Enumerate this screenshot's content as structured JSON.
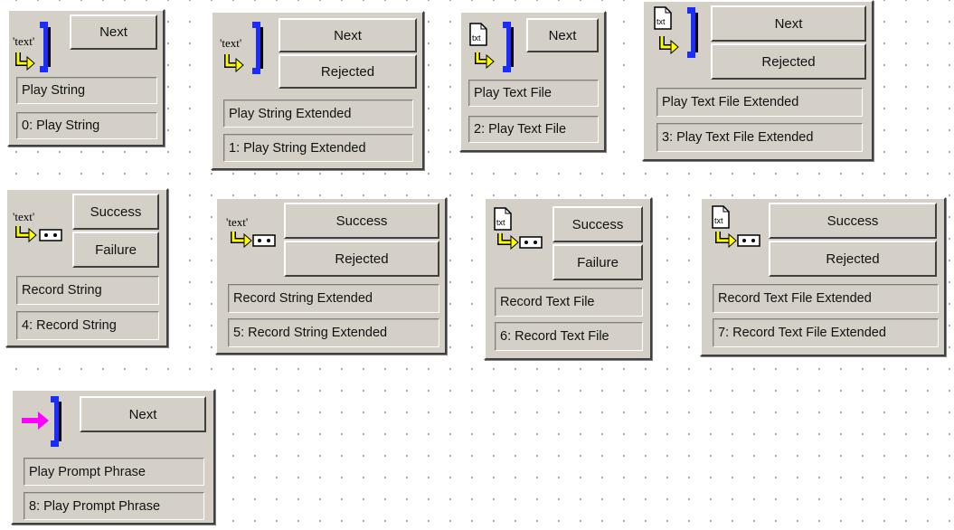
{
  "colors": {
    "panel": "#d4d0c8",
    "handset_blue": "#1a2cff",
    "arrow_yellow": "#ffff00",
    "arrow_magenta": "#ff00ff"
  },
  "blocks": [
    {
      "icon": "text-play-icon",
      "buttons": [
        "Next"
      ],
      "name": "Play String",
      "id": "0: Play String"
    },
    {
      "icon": "text-play-icon",
      "buttons": [
        "Next",
        "Rejected"
      ],
      "name": "Play String Extended",
      "id": "1: Play String Extended"
    },
    {
      "icon": "file-play-icon",
      "buttons": [
        "Next"
      ],
      "name": "Play Text File",
      "id": "2: Play Text File"
    },
    {
      "icon": "file-play-icon",
      "buttons": [
        "Next",
        "Rejected"
      ],
      "name": "Play Text File Extended",
      "id": "3: Play Text File Extended"
    },
    {
      "icon": "text-record-icon",
      "buttons": [
        "Success",
        "Failure"
      ],
      "name": "Record String",
      "id": "4: Record String"
    },
    {
      "icon": "text-record-icon",
      "buttons": [
        "Success",
        "Rejected"
      ],
      "name": "Record String Extended",
      "id": "5: Record String Extended"
    },
    {
      "icon": "file-record-icon",
      "buttons": [
        "Success",
        "Failure"
      ],
      "name": "Record Text File",
      "id": "6: Record Text File"
    },
    {
      "icon": "file-record-icon",
      "buttons": [
        "Success",
        "Rejected"
      ],
      "name": "Record Text File Extended",
      "id": "7: Record Text File Extended"
    },
    {
      "icon": "prompt-phrase-icon",
      "buttons": [
        "Next"
      ],
      "name": "Play Prompt Phrase",
      "id": "8: Play Prompt Phrase"
    }
  ],
  "icon_text": {
    "text_label": "'text'",
    "file_label": "txt"
  }
}
